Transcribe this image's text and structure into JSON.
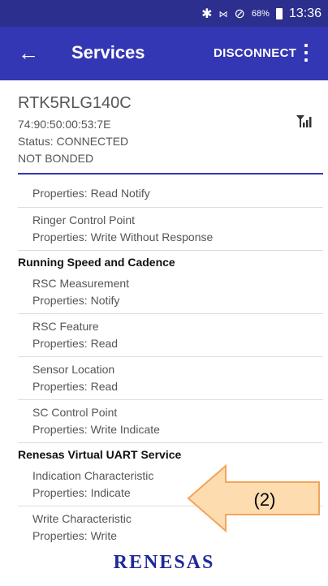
{
  "status": {
    "percent": "68%",
    "time": "13:36"
  },
  "appbar": {
    "title": "Services",
    "disconnect": "DISCONNECT"
  },
  "device": {
    "name": "RTK5RLG140C",
    "mac": "74:90:50:00:53:7E",
    "status": "Status: CONNECTED",
    "bond": "NOT BONDED"
  },
  "list": {
    "r0": "Properties: Read Notify",
    "r1a": "Ringer Control Point",
    "r1b": "Properties: Write Without Response",
    "s1": "Running Speed and Cadence",
    "r2a": "RSC Measurement",
    "r2b": "Properties: Notify",
    "r3a": "RSC Feature",
    "r3b": "Properties: Read",
    "r4a": "Sensor Location",
    "r4b": "Properties: Read",
    "r5a": "SC Control Point",
    "r5b": "Properties: Write Indicate",
    "s2": "Renesas Virtual UART Service",
    "r6a": "Indication Characteristic",
    "r6b": "Properties: Indicate",
    "r7a": "Write Characteristic",
    "r7b": "Properties: Write"
  },
  "annotation": {
    "label": "(2)"
  },
  "logo": "RENESAS",
  "colors": {
    "appbar": "#3437b3",
    "statusbar": "#2d2f8e",
    "arrow_fill": "#fddcb0",
    "arrow_stroke": "#f2a55a"
  }
}
